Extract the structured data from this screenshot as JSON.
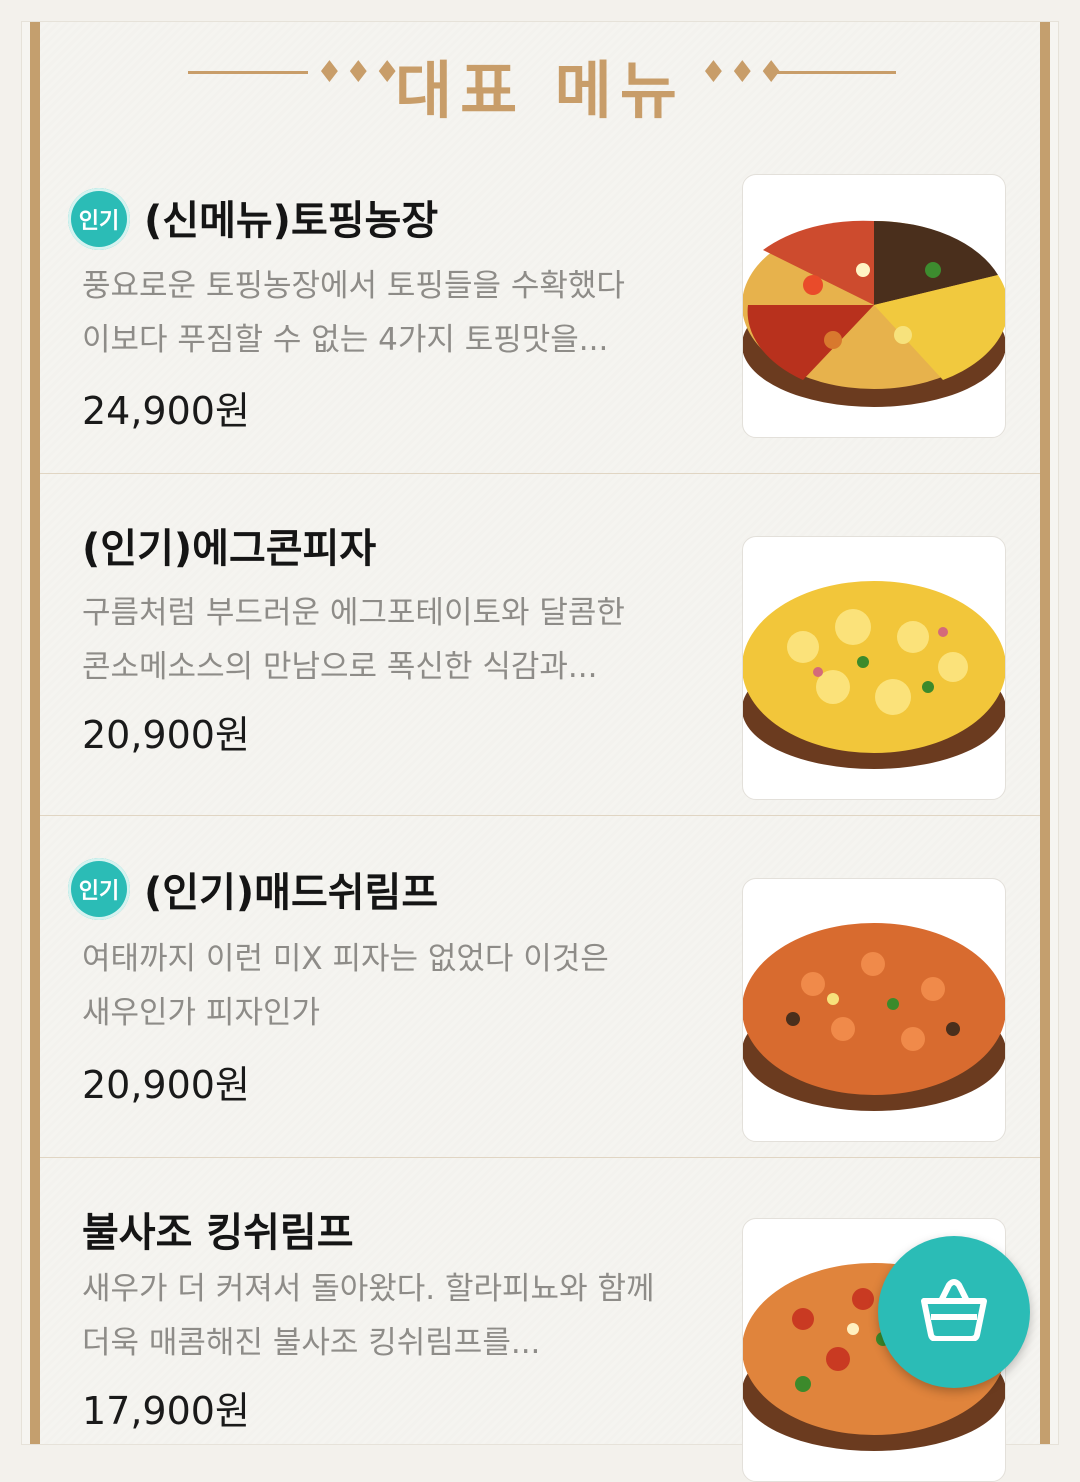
{
  "header": {
    "title": "대표 메뉴",
    "left_deco": "♦♦♦",
    "right_deco": "♦♦♦"
  },
  "menu": {
    "items": [
      {
        "badge": "인기",
        "name": "(신메뉴)토핑농장",
        "desc_line1": "풍요로운 토핑농장에서 토핑들을 수확했다",
        "desc_line2": "이보다 푸짐할 수 없는 4가지 토핑맛을...",
        "price": "24,900원"
      },
      {
        "name": "(인기)에그콘피자",
        "desc_line1": "구름처럼 부드러운 에그포테이토와 달콤한",
        "desc_line2": "콘소메소스의 만남으로 폭신한 식감과...",
        "price": "20,900원"
      },
      {
        "badge": "인기",
        "name": "(인기)매드쉬림프",
        "desc_line1": "여태까지 이런 미X 피자는 없었다 이것은",
        "desc_line2": "새우인가 피자인가",
        "price": "20,900원"
      },
      {
        "name": "불사조 킹쉬림프",
        "desc_line1": "새우가 더 커져서 돌아왔다. 할라피뇨와 함께",
        "desc_line2": "더욱 매콤해진 불사조 킹쉬림프를...",
        "price": "17,900원"
      }
    ]
  },
  "colors": {
    "accent": "#2bbcb6",
    "gold": "#c89d69"
  },
  "icons": {
    "cart": "shopping-basket-icon"
  }
}
